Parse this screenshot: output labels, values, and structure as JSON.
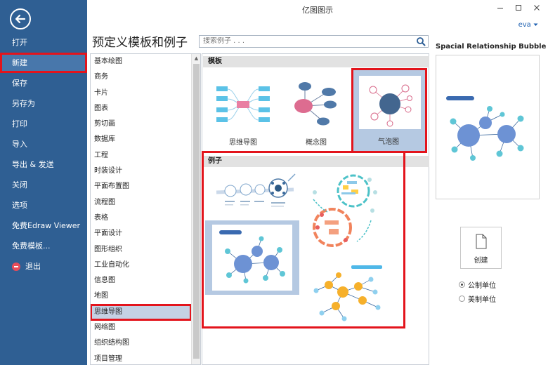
{
  "window": {
    "title": "亿图图示",
    "user": "eva"
  },
  "sidebar": {
    "items": [
      {
        "label": "打开"
      },
      {
        "label": "新建"
      },
      {
        "label": "保存"
      },
      {
        "label": "另存为"
      },
      {
        "label": "打印"
      },
      {
        "label": "导入"
      },
      {
        "label": "导出 & 发送"
      },
      {
        "label": "关闭"
      },
      {
        "label": "选项"
      },
      {
        "label": "免费Edraw Viewer"
      },
      {
        "label": "免费模板..."
      },
      {
        "label": "退出"
      }
    ],
    "active_index": 1,
    "colors": {
      "background": "#2f5f93",
      "active": "#4877ab",
      "highlight": "#e3141c"
    }
  },
  "main": {
    "heading": "预定义模板和例子",
    "search": {
      "placeholder": "搜索例子 . . ."
    }
  },
  "categories": [
    "基本绘图",
    "商务",
    "卡片",
    "图表",
    "剪切画",
    "数据库",
    "工程",
    "时装设计",
    "平面布置图",
    "流程图",
    "表格",
    "平面设计",
    "图形组织",
    "工业自动化",
    "信息图",
    "地图",
    "思维导图",
    "网络图",
    "组织结构图",
    "项目管理"
  ],
  "selected_category": "思维导图",
  "templates_section": {
    "header": "模板",
    "items": [
      {
        "label": "思维导图",
        "icon": "mindmap-thumbnail-icon"
      },
      {
        "label": "概念图",
        "icon": "concept-map-thumbnail-icon"
      },
      {
        "label": "气泡图",
        "icon": "bubble-chart-thumbnail-icon",
        "selected": true
      }
    ]
  },
  "examples_section": {
    "header": "例子",
    "items": [
      {
        "icon": "example-infographic-thumbnail"
      },
      {
        "icon": "example-circular-mindmap-thumbnail"
      },
      {
        "icon": "example-bubble-diagram-thumbnail",
        "selected": true
      },
      {
        "icon": "example-orange-network-thumbnail"
      }
    ]
  },
  "preview": {
    "title": "Spacial Relationship Bubble ...",
    "create_label": "创建",
    "units": [
      {
        "label": "公制单位",
        "checked": true
      },
      {
        "label": "美制单位",
        "checked": false
      }
    ]
  }
}
